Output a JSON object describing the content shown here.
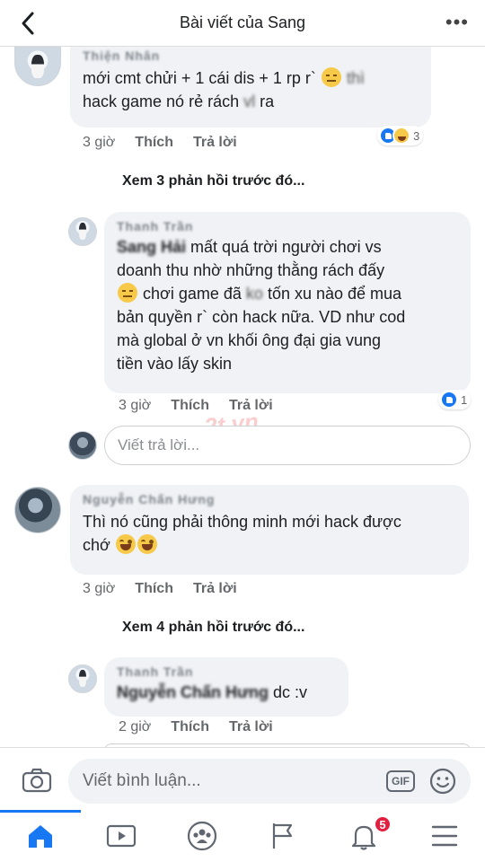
{
  "header": {
    "title": "Bài viết của Sang",
    "more_label": "•••"
  },
  "comments": [
    {
      "name": "Thiện Nhân",
      "line1_text": "mới cmt chửi + 1 cái dis + 1 rp r`",
      "line1_tail": "thì",
      "line2_text": "hack game nó rẻ rách",
      "line2_blur": "vl",
      "line2_end": "ra",
      "time": "3 giờ",
      "like": "Thích",
      "reply": "Trả lời",
      "reaction_count": "3"
    }
  ],
  "view_replies_1": "Xem 3 phản hồi trước đó...",
  "reply1": {
    "name": "Thanh Trần",
    "mention": "Sang Hải",
    "text_a": "mất quá trời người chơi vs",
    "text_b": "doanh thu nhờ những thằng rách đấy",
    "text_c1": "chơi game đã",
    "text_c_blur": "ko",
    "text_c2": "tốn xu nào để mua",
    "text_d": "bản quyền r` còn hack nữa. VD như cod",
    "text_e": "mà global ở vn khối ông đại gia vung",
    "text_f": "tiền vào lấy skin",
    "time": "3 giờ",
    "like": "Thích",
    "reply": "Trả lời",
    "reaction_count": "1"
  },
  "reply_input_placeholder": "Viết trả lời...",
  "comment2": {
    "name": "Nguyễn Chấn Hưng",
    "text_a": "Thì nó cũng phải thông minh mới hack được",
    "text_b": "chớ",
    "time": "3 giờ",
    "like": "Thích",
    "reply": "Trả lời"
  },
  "view_replies_2": "Xem 4 phản hồi trước đó...",
  "reply2": {
    "name": "Thanh Trần",
    "mention": "Nguyễn Chấn Hưng",
    "text": "dc :v",
    "time": "2 giờ",
    "like": "Thích",
    "reply": "Trả lời"
  },
  "watermark": "2t.vn",
  "composer": {
    "placeholder": "Viết bình luận...",
    "gif_label": "GIF"
  },
  "tabbar": {
    "notifications_badge": "5"
  },
  "colors": {
    "accent": "#1877f2",
    "bubble": "#f0f2f5",
    "badge": "#e41e3f"
  }
}
